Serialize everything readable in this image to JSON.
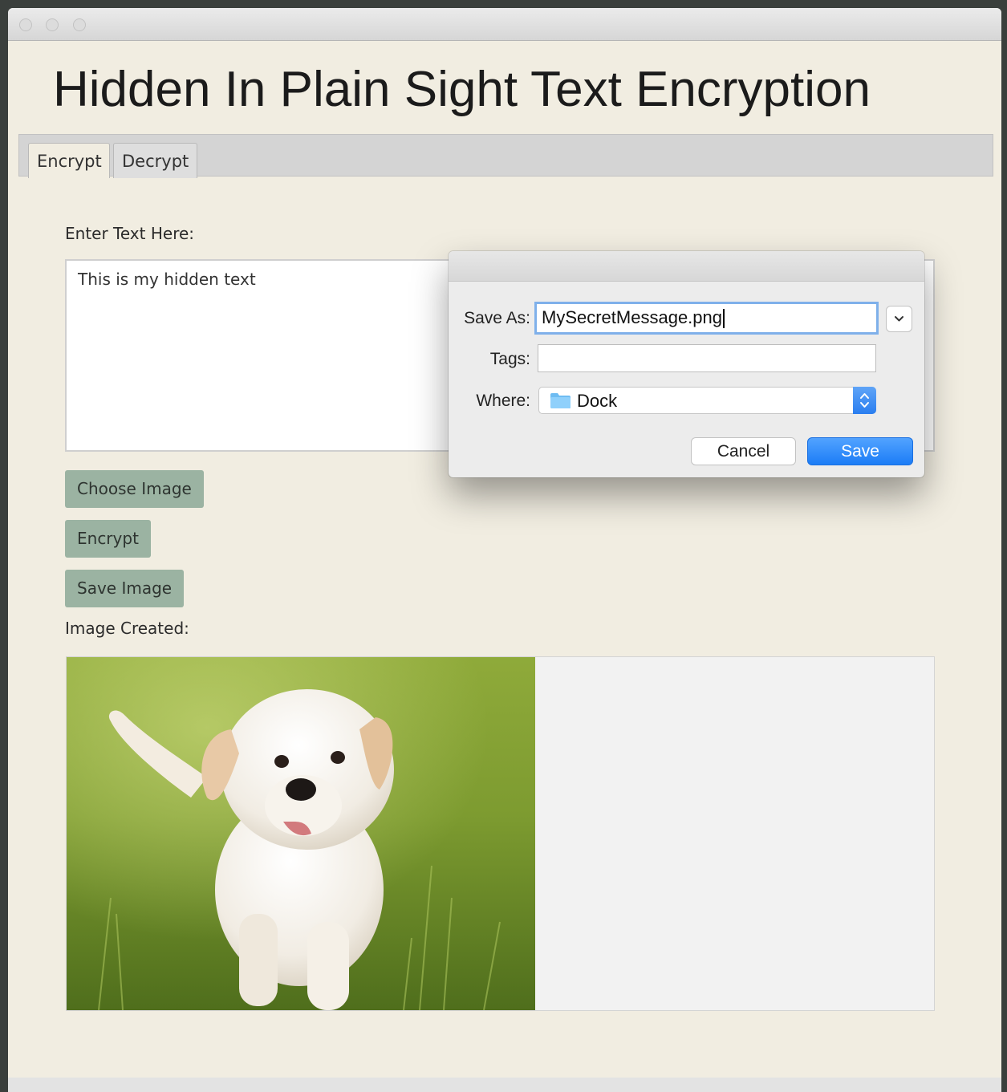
{
  "app": {
    "title": "Hidden In Plain Sight Text Encryption"
  },
  "tabs": [
    {
      "label": "Encrypt",
      "active": true
    },
    {
      "label": "Decrypt",
      "active": false
    }
  ],
  "encrypt": {
    "input_label": "Enter Text Here:",
    "input_text": "This is my hidden text",
    "choose_image_label": "Choose Image",
    "encrypt_label": "Encrypt",
    "save_image_label": "Save Image",
    "image_created_label": "Image Created:"
  },
  "save_dialog": {
    "save_as_label": "Save As:",
    "save_as_value": "MySecretMessage.png",
    "tags_label": "Tags:",
    "tags_value": "",
    "where_label": "Where:",
    "where_value": "Dock",
    "cancel_label": "Cancel",
    "save_label": "Save"
  },
  "colors": {
    "window_bg": "#f1ede1",
    "button_bg": "#9bb3a2",
    "accent": "#1b7cf6",
    "focus_ring": "#7fb0ea"
  }
}
